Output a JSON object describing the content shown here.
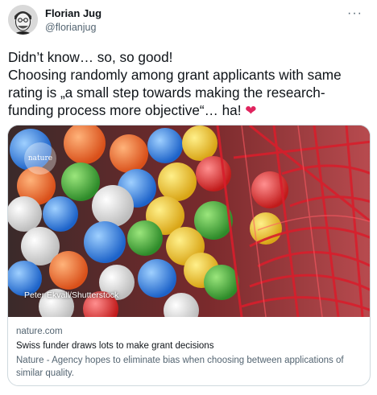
{
  "author": {
    "name": "Florian Jug",
    "handle": "@florianjug"
  },
  "menu": {
    "more_label": "···"
  },
  "tweet": {
    "line1": "Didn’t know… so, so good!",
    "line2": "Choosing randomly among grant applicants with same",
    "line3": "rating is „a small step towards making the research-",
    "line4": "funding process more objective“… ha!",
    "emoji": "❤",
    "heart_color": "#e0245e"
  },
  "card": {
    "image_logo_text": "nature",
    "image_credit": "Peter Ekvall/Shutterstock",
    "domain": "nature.com",
    "title": "Swiss funder draws lots to make grant decisions",
    "description_line1": "Nature - Agency hopes to eliminate bias when choosing between applications of",
    "description_line2": "similar quality."
  },
  "colors": {
    "text_primary": "#0f1419",
    "text_secondary": "#536471",
    "border": "#cfd9de"
  }
}
